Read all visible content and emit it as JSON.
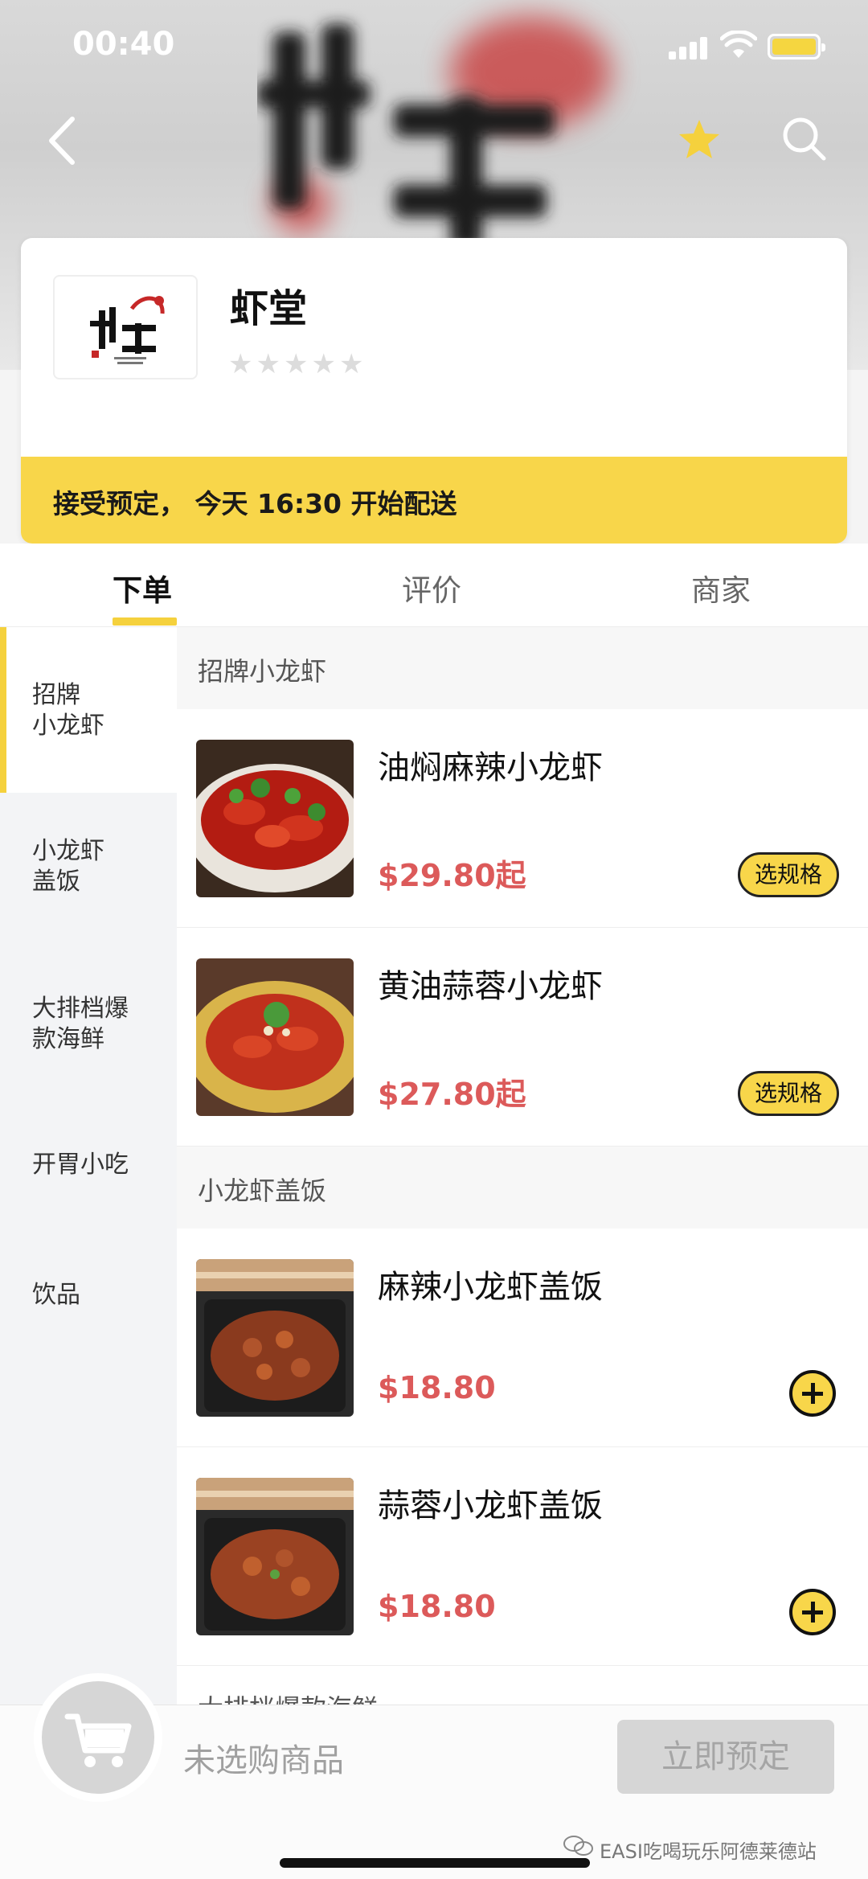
{
  "status_bar": {
    "time": "00:40"
  },
  "shop": {
    "name": "虾堂",
    "rating_stars": 5,
    "notice": "接受预定， 今天 16:30 开始配送"
  },
  "tabs": [
    {
      "label": "下单",
      "active": true
    },
    {
      "label": "评价",
      "active": false
    },
    {
      "label": "商家",
      "active": false
    }
  ],
  "sidebar": {
    "items": [
      {
        "label": "招牌\n小龙虾",
        "active": true
      },
      {
        "label": "小龙虾\n盖饭",
        "active": false
      },
      {
        "label": "大排档爆\n款海鲜",
        "active": false
      },
      {
        "label": "开胃小吃",
        "active": false
      },
      {
        "label": "饮品",
        "active": false
      }
    ]
  },
  "menu": {
    "sections": [
      {
        "title": "招牌小龙虾",
        "dishes": [
          {
            "name": "油焖麻辣小龙虾",
            "price": "$29.80起",
            "action": "选规格"
          },
          {
            "name": "黄油蒜蓉小龙虾",
            "price": "$27.80起",
            "action": "选规格"
          }
        ]
      },
      {
        "title": "小龙虾盖饭",
        "dishes": [
          {
            "name": "麻辣小龙虾盖饭",
            "price": "$18.80",
            "action": "add"
          },
          {
            "name": "蒜蓉小龙虾盖饭",
            "price": "$18.80",
            "action": "add"
          }
        ]
      }
    ],
    "peek_section_title": "大排档爆款海鲜"
  },
  "bottom_bar": {
    "cart_text": "未选购商品",
    "order_button": "立即预定",
    "watermark": "EASI吃喝玩乐阿德莱德站"
  },
  "colors": {
    "accent": "#f8d64a",
    "price": "#dc5a5a"
  },
  "icons": [
    "back-icon",
    "star-icon",
    "search-icon",
    "cart-icon",
    "plus-icon",
    "wechat-icon"
  ]
}
